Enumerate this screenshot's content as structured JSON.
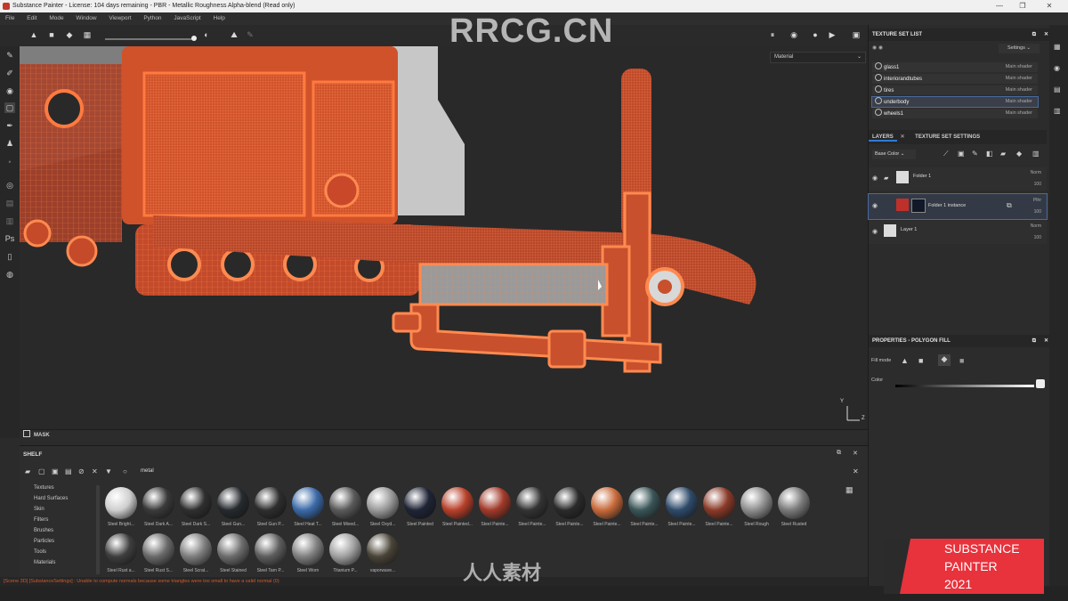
{
  "window": {
    "title": "Substance Painter - License: 104 days remaining - PBR - Metallic Roughness Alpha-blend (Read only)"
  },
  "menu": [
    "File",
    "Edit",
    "Mode",
    "Window",
    "Viewport",
    "Python",
    "JavaScript",
    "Help"
  ],
  "viewport": {
    "channel_select": "Material",
    "axis_y": "Y",
    "axis_z": "Z"
  },
  "mask": {
    "label": "MASK"
  },
  "shelf": {
    "title": "SHELF",
    "search_value": "metal",
    "categories": [
      "Textures",
      "Hard Surfaces",
      "Skin",
      "Filters",
      "Brushes",
      "Particles",
      "Tools",
      "Materials"
    ],
    "materials_row1": [
      {
        "label": "Steel Bright...",
        "color": "#cfcfcf"
      },
      {
        "label": "Steel Dark A...",
        "color": "#3a3a3a"
      },
      {
        "label": "Steel Dark S...",
        "color": "#2f2f2f"
      },
      {
        "label": "Steel Gun...",
        "color": "#262a2e"
      },
      {
        "label": "Steel Gun P...",
        "color": "#2e2e2e"
      },
      {
        "label": "Steel Heat T...",
        "color": "#3b6aa8"
      },
      {
        "label": "Steel Mixed...",
        "color": "#5a5a5a"
      },
      {
        "label": "Steel Oxyd...",
        "color": "#9a9a9a"
      },
      {
        "label": "Steel Painted",
        "color": "#1f2436"
      },
      {
        "label": "Steel Painted...",
        "color": "#b8402a"
      },
      {
        "label": "Steel Painte...",
        "color": "#a23a2a"
      },
      {
        "label": "Steel Painte...",
        "color": "#333"
      },
      {
        "label": "Steel Painte...",
        "color": "#2a2a2a"
      },
      {
        "label": "Steel Painte...",
        "color": "#c86a3a"
      },
      {
        "label": "Steel Painte...",
        "color": "#3a5558"
      },
      {
        "label": "Steel Painte...",
        "color": "#2e4a6a"
      },
      {
        "label": "Steel Painte...",
        "color": "#8a3a28"
      },
      {
        "label": "Steel Rough",
        "color": "#8e8e8e"
      },
      {
        "label": "Steel Rusted",
        "color": "#7a7a7a"
      }
    ],
    "materials_row2": [
      {
        "label": "Steel Rust a...",
        "color": "#3e3e3e"
      },
      {
        "label": "Steel Rust S...",
        "color": "#6a6a6a"
      },
      {
        "label": "Steel Scrat...",
        "color": "#7e7e7e"
      },
      {
        "label": "Steel Stained",
        "color": "#6c6c6c"
      },
      {
        "label": "Steel Tarn P...",
        "color": "#5e5e5e"
      },
      {
        "label": "Steel Worn",
        "color": "#808080"
      },
      {
        "label": "Titanium P...",
        "color": "#a0a0a0"
      },
      {
        "label": "vaporwave...",
        "color": "#4a4438"
      }
    ]
  },
  "status": {
    "text": "[Scene 3D] [SubstanceSettings] : Unable to compute normals because some triangles were too small to have a valid normal (0)"
  },
  "texture_set_list": {
    "title": "TEXTURE SET LIST",
    "settings_label": "Settings",
    "items": [
      {
        "name": "glass1",
        "shader": "Main shader"
      },
      {
        "name": "interiorandtubes",
        "shader": "Main shader"
      },
      {
        "name": "tires",
        "shader": "Main shader"
      },
      {
        "name": "underbody",
        "shader": "Main shader"
      },
      {
        "name": "wheels1",
        "shader": "Main shader"
      }
    ]
  },
  "layers": {
    "tab_layers": "LAYERS",
    "tab_settings": "TEXTURE SET SETTINGS",
    "channel": "Base Color",
    "rows": [
      {
        "name": "Folder 1",
        "blend": "Norm",
        "opacity": "100"
      },
      {
        "name": "Folder 1 instance",
        "blend": "Pthr",
        "opacity": "100"
      },
      {
        "name": "Layer 1",
        "blend": "Norm",
        "opacity": "100"
      }
    ]
  },
  "properties": {
    "title": "PROPERTIES - POLYGON FILL",
    "fill_mode_label": "Fill mode",
    "color_label": "Color"
  },
  "watermarks": {
    "top": "RRCG.CN",
    "bottom": "人人素材"
  },
  "logo": {
    "line1": "SUBSTANCE",
    "line2": "PAINTER",
    "line3": "2021"
  }
}
